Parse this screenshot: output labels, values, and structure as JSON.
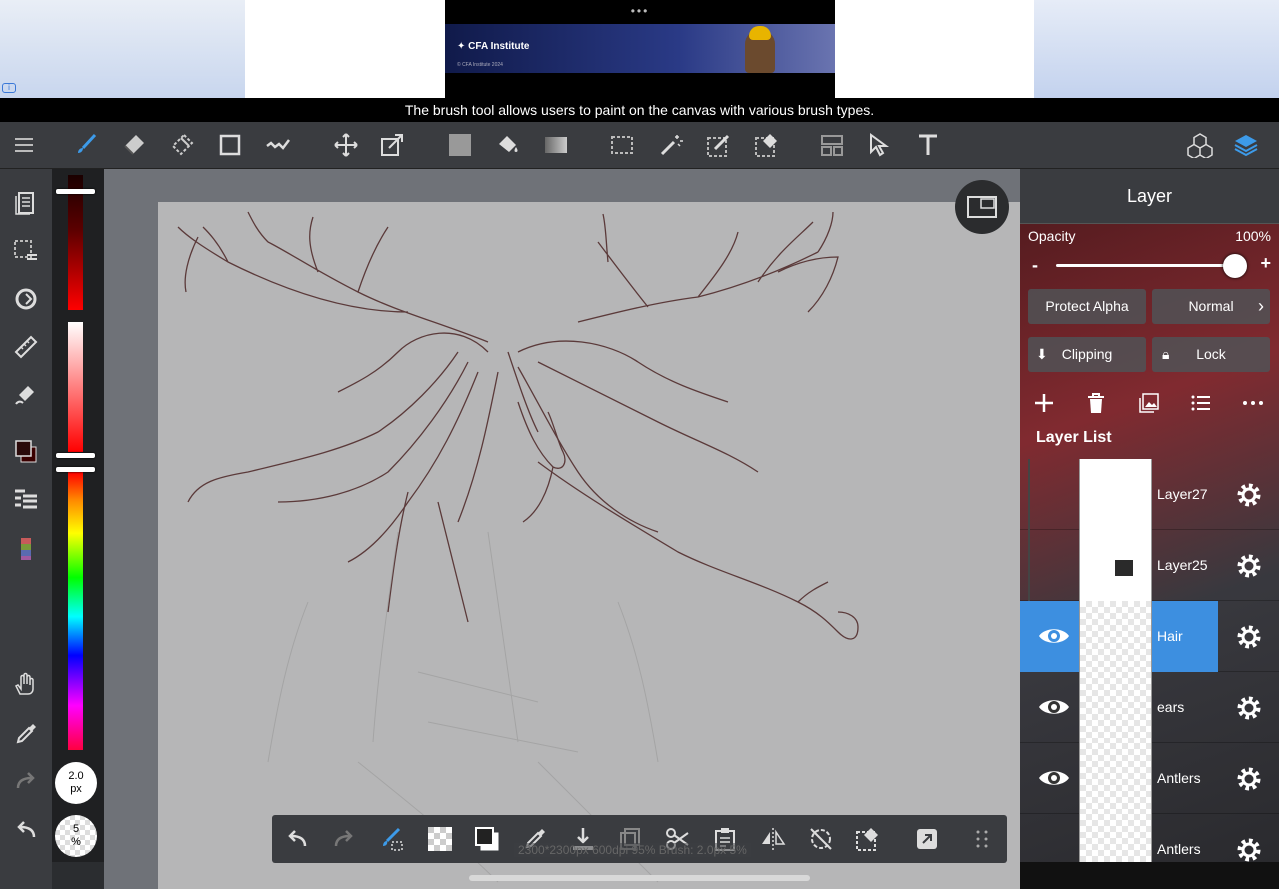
{
  "ad": {
    "dots": "•••",
    "brand": "CFA Institute",
    "copyright": "© CFA Institute 2024",
    "info_badge": "i"
  },
  "tooltip": "The brush tool allows users to paint on the canvas with various brush types.",
  "toolbar": {
    "icons": [
      "menu-icon",
      "brush-icon",
      "eraser-icon",
      "blur-icon",
      "rectangle-icon",
      "correction-icon",
      "move-icon",
      "transform-icon",
      "fill-color-icon",
      "bucket-icon",
      "gradient-icon",
      "select-icon",
      "magic-wand-icon",
      "select-pen-icon",
      "select-eraser-icon",
      "frame-icon",
      "selection-arrow-icon",
      "text-icon",
      "3d-material-icon",
      "layers-icon"
    ],
    "active_tool": "brush",
    "accent": "#3d9be9"
  },
  "left_bar": {
    "icons": [
      "pages-icon",
      "selection-icon",
      "rotate-icon",
      "ruler-icon",
      "fill-icon",
      "color-swatch-icon",
      "layer-list-icon",
      "palette-icon",
      "hand-icon",
      "eyedropper-icon",
      "redo-icon",
      "undo-icon"
    ]
  },
  "color": {
    "foreground": "#2a0a0a",
    "brush_size": "2.0",
    "brush_size_unit": "px",
    "brush_opacity": "5",
    "brush_opacity_unit": "%"
  },
  "canvas": {
    "status": "2300*2300px 600dpi 95% Brush: 2.0px 5%"
  },
  "layer_panel": {
    "title": "Layer",
    "opacity_label": "Opacity",
    "opacity_value": "100%",
    "opacity_fraction": 1.0,
    "minus": "-",
    "plus": "+",
    "protect_alpha": "Protect Alpha",
    "blend_mode": "Normal",
    "clipping": "Clipping",
    "lock": "Lock",
    "list_title": "Layer List",
    "layers": [
      {
        "name": "Layer27",
        "visible": false,
        "selected": false
      },
      {
        "name": "Layer25",
        "visible": false,
        "selected": false
      },
      {
        "name": "Hair",
        "visible": true,
        "selected": true
      },
      {
        "name": "ears",
        "visible": true,
        "selected": false
      },
      {
        "name": "Antlers",
        "visible": true,
        "selected": false
      },
      {
        "name": "Antlers",
        "visible": false,
        "selected": false
      }
    ],
    "selected_color": "#3d8fe0"
  }
}
